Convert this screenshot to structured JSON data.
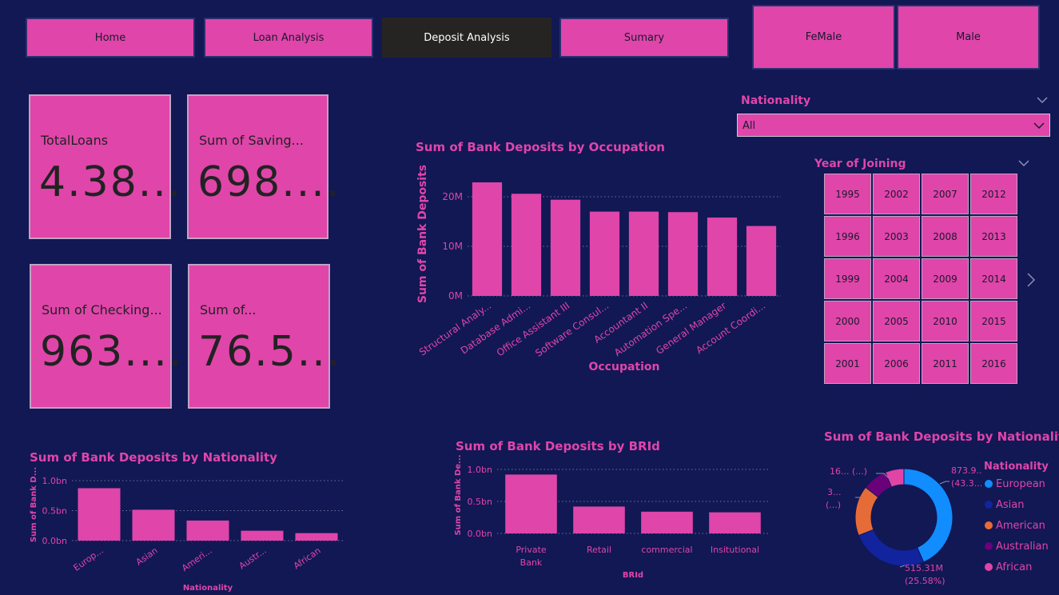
{
  "nav": {
    "home": "Home",
    "loan": "Loan Analysis",
    "deposit": "Deposit Analysis",
    "summary": "Sumary",
    "female": "FeMale",
    "male": "Male"
  },
  "cards": [
    {
      "label": "TotalLoans",
      "value": "4.38..."
    },
    {
      "label": "Sum of Saving...",
      "value": "698...."
    },
    {
      "label": "Sum of Checking...",
      "value": "963...."
    },
    {
      "label": "Sum of...",
      "value": "76.5..."
    }
  ],
  "nationality_slicer": {
    "title": "Nationality",
    "value": "All"
  },
  "year_slicer": {
    "title": "Year of Joining",
    "years": [
      "1995",
      "2002",
      "2007",
      "2012",
      "1996",
      "2003",
      "2008",
      "2013",
      "1999",
      "2004",
      "2009",
      "2014",
      "2000",
      "2005",
      "2010",
      "2015",
      "2001",
      "2006",
      "2011",
      "2016"
    ]
  },
  "colors": {
    "accent": "#e045aa",
    "background": "#111854",
    "active": "#252423"
  },
  "icons": {
    "dropdown": "chevron-down-icon",
    "next": "chevron-right-icon"
  },
  "chart_data": [
    {
      "type": "bar",
      "title": "Sum of Bank Deposits by Occupation",
      "xlabel": "Occupation",
      "ylabel": "Sum of Bank Deposits",
      "categories": [
        "Structural Analy...",
        "Database Admi...",
        "Office Assistant III",
        "Software Consul...",
        "Accountant II",
        "Automation Spe...",
        "General Manager",
        "Account Coordi..."
      ],
      "values": [
        22.9,
        20.6,
        19.4,
        17.0,
        17.0,
        16.9,
        15.8,
        14.1
      ],
      "unit": "M",
      "ylim": [
        0,
        25
      ],
      "yticks": [
        "0M",
        "10M",
        "20M"
      ],
      "grid": true
    },
    {
      "type": "bar",
      "title": "Sum of Bank Deposits by Nationality",
      "xlabel": "Nationality",
      "ylabel": "Sum of Bank D...",
      "categories": [
        "Europ...",
        "Asian",
        "Ameri...",
        "Austr...",
        "African"
      ],
      "values": [
        0.874,
        0.515,
        0.335,
        0.165,
        0.125
      ],
      "ylim": [
        0,
        1.2
      ],
      "yticks": [
        "0.0bn",
        "0.5bn",
        "1.0bn"
      ],
      "grid": true
    },
    {
      "type": "bar",
      "title": "Sum of Bank Deposits by BRId",
      "xlabel": "BRId",
      "ylabel": "Sum of Bank De...",
      "categories": [
        "Private Bank",
        "Retail",
        "commercial",
        "Insitutional"
      ],
      "values": [
        0.92,
        0.42,
        0.34,
        0.33
      ],
      "ylim": [
        0,
        1.2
      ],
      "yticks": [
        "0.0bn",
        "0.5bn",
        "1.0bn"
      ],
      "grid": true
    },
    {
      "type": "pie",
      "title": "Sum of Bank Deposits by Nationality",
      "legend_title": "Nationality",
      "legend_position": "right",
      "categories": [
        "European",
        "Asian",
        "American",
        "Australian",
        "African"
      ],
      "values": [
        873.9,
        515.31,
        335,
        165,
        125
      ],
      "colors": [
        "#118dff",
        "#12239e",
        "#e66c37",
        "#6b007b",
        "#e044a7"
      ],
      "labels": [
        {
          "text": "873.9...",
          "sub": "(43.3...)"
        },
        {
          "text": "515.31M",
          "sub": "(25.58%)"
        },
        {
          "text": "3...",
          "sub": "(...)"
        },
        {
          "text": "16... (...)",
          "sub": ""
        }
      ]
    }
  ]
}
